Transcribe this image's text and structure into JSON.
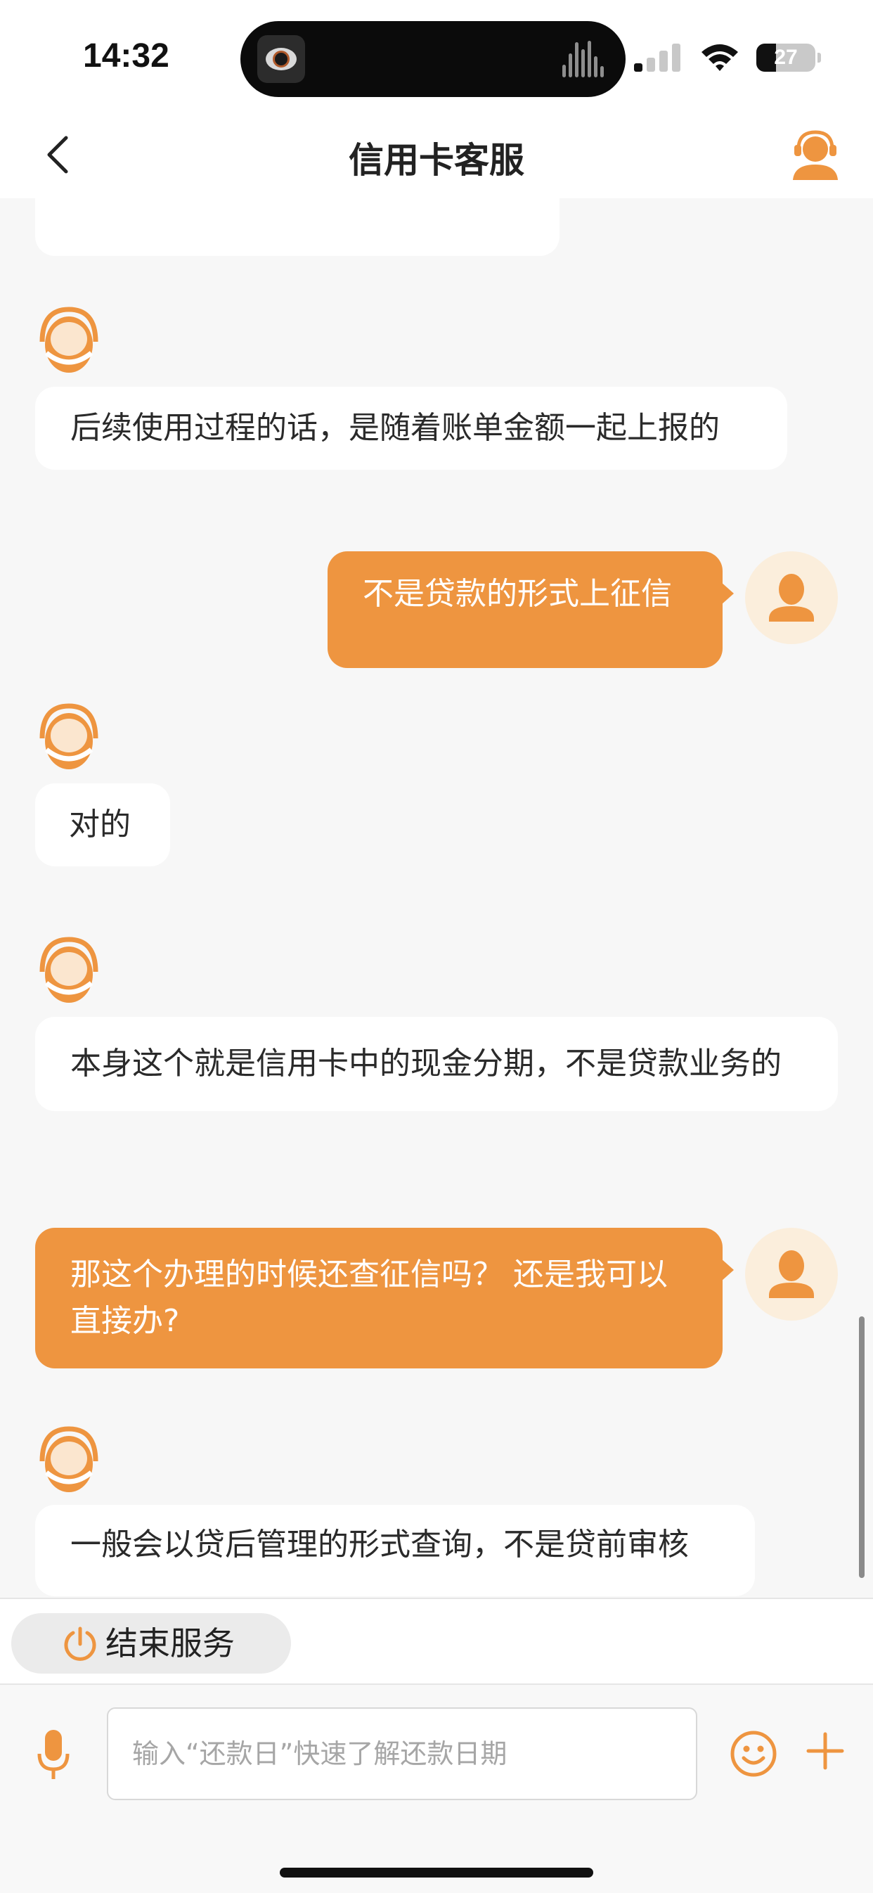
{
  "status_bar": {
    "time": "14:32",
    "battery_level": "27"
  },
  "nav": {
    "title": "信用卡客服",
    "back_icon": "chevron-left-icon",
    "agent_icon": "customer-service-headset-icon"
  },
  "messages": [
    {
      "sender": "agent",
      "text": "后续使用过程的话，是随着账单金额一起上报的"
    },
    {
      "sender": "user",
      "text": "不是贷款的形式上征信"
    },
    {
      "sender": "agent",
      "text": "对的"
    },
    {
      "sender": "agent",
      "text": "本身这个就是信用卡中的现金分期，不是贷款业务的"
    },
    {
      "sender": "user",
      "text": "那这个办理的时候还查征信吗？ 还是我可以直接办?"
    },
    {
      "sender": "agent",
      "text": "一般会以贷后管理的形式查询，不是贷前审核"
    }
  ],
  "end_service": {
    "label": "结束服务",
    "icon": "power-icon"
  },
  "input": {
    "placeholder": "输入“还款日”快速了解还款日期",
    "value": ""
  },
  "colors": {
    "accent": "#ee9540",
    "background": "#f7f7f7",
    "bubble_agent": "#ffffff"
  }
}
